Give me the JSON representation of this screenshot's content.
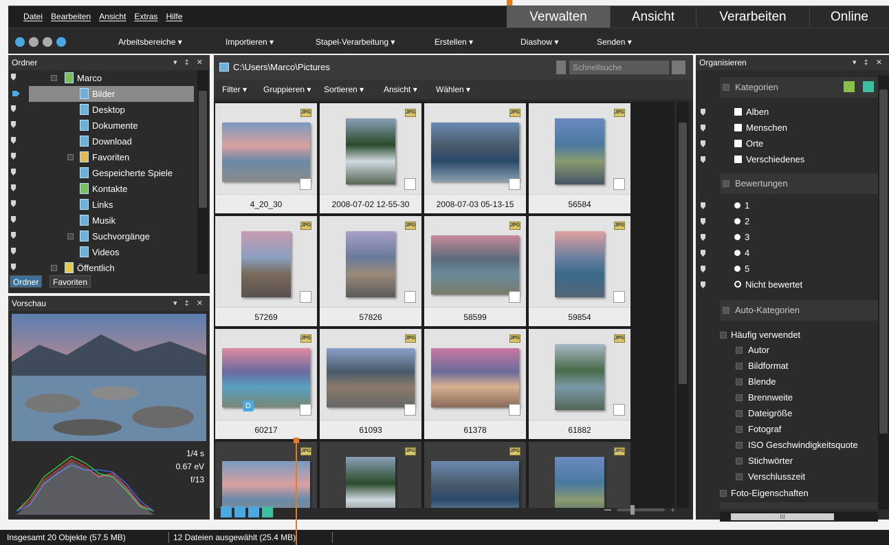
{
  "menu": [
    "Datei",
    "Bearbeiten",
    "Ansicht",
    "Extras",
    "Hilfe"
  ],
  "mode_tabs": [
    "Verwalten",
    "Ansicht",
    "Verarbeiten",
    "Online"
  ],
  "toolbar": {
    "workspaces": "Arbeitsbereiche",
    "import": "Importieren",
    "batch": "Stapel-Verarbeitung",
    "create": "Erstellen",
    "slideshow": "Diashow",
    "send": "Senden"
  },
  "folders_panel": {
    "title": "Ordner",
    "items": [
      "Marco",
      "Bilder",
      "Desktop",
      "Dokumente",
      "Download",
      "Favoriten",
      "Gespeicherte Spiele",
      "Kontakte",
      "Links",
      "Musik",
      "Suchvorgänge",
      "Videos",
      "Öffentlich"
    ],
    "tabs": [
      "Ordner",
      "Favoriten"
    ]
  },
  "preview_panel": {
    "title": "Vorschau",
    "exif": {
      "shutter": "1/4 s",
      "ev": "0.67 eV",
      "aperture": "f/13"
    }
  },
  "browser": {
    "path": "C:\\Users\\Marco\\Pictures",
    "search_placeholder": "Schnellsuche",
    "filters": [
      "Filter",
      "Gruppieren",
      "Sortieren",
      "Ansicht",
      "Wählen"
    ],
    "badge": "JPG",
    "captions": [
      "4_20_30",
      "2008-07-02 12-55-30",
      "2008-07-03 05-13-15",
      "56584",
      "57269",
      "57826",
      "58599",
      "59854",
      "60217",
      "61093",
      "61378",
      "61882"
    ],
    "d_label": "D"
  },
  "organize_panel": {
    "title": "Organisieren",
    "categories_header": "Kategorien",
    "categories": [
      "Alben",
      "Menschen",
      "Orte",
      "Verschiedenes"
    ],
    "ratings_header": "Bewertungen",
    "ratings": [
      "1",
      "2",
      "3",
      "4",
      "5",
      "Nicht bewertet"
    ],
    "auto_header": "Auto-Kategorien",
    "frequent": "Häufig verwendet",
    "auto_items": [
      "Autor",
      "Bildformat",
      "Blende",
      "Brennweite",
      "Dateigröße",
      "Fotograf",
      "ISO Geschwindigkeitsquote",
      "Stichwörter",
      "Verschlusszeit"
    ],
    "photo_props": "Foto-Eigenschaften",
    "scroll_dots": "III"
  },
  "status": {
    "total": "Insgesamt 20 Objekte (57.5 MB)",
    "selected": "12 Dateien ausgewählt (25.4 MB)"
  }
}
